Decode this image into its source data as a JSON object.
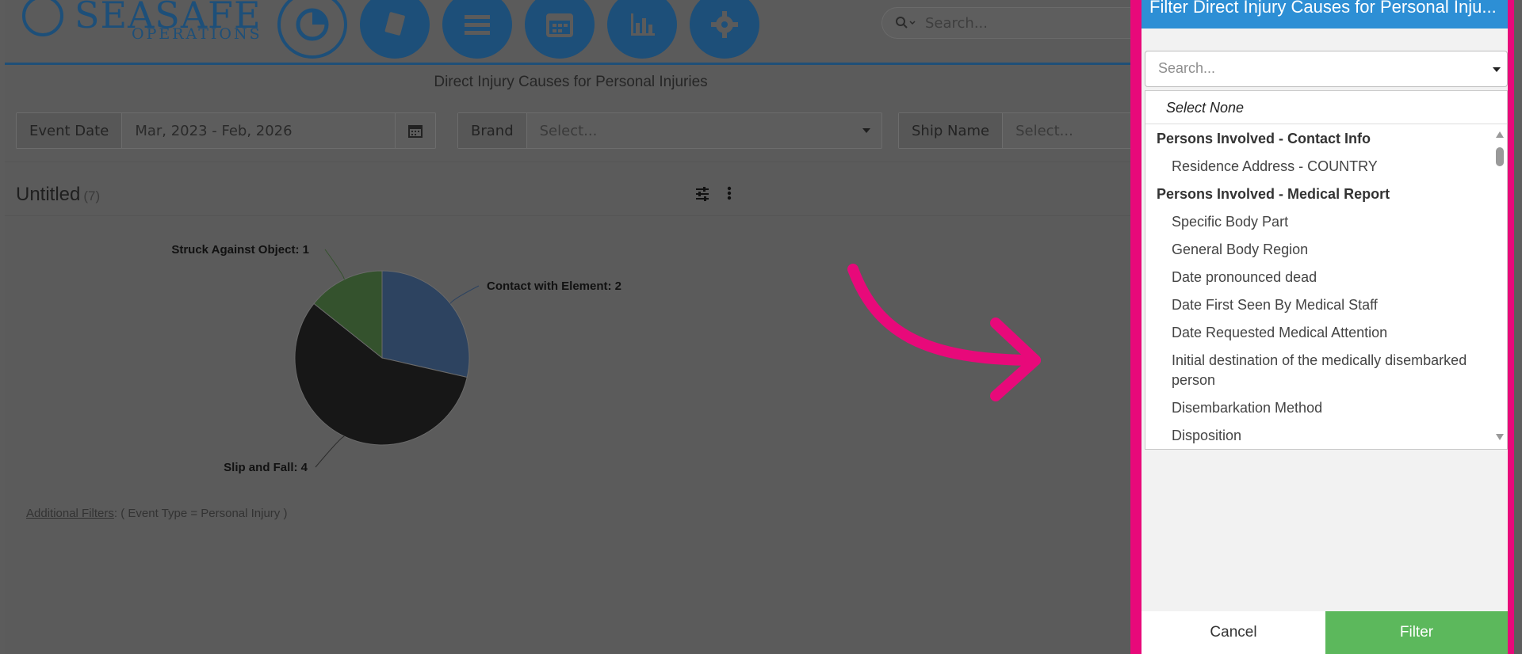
{
  "header": {
    "logo_main": "SEASAFE",
    "logo_sub": "OPERATIONS",
    "nav_icons": [
      "pie-chart-icon",
      "book-icon",
      "menu-icon",
      "calendar-icon",
      "bar-chart-icon",
      "gear-icon"
    ],
    "search_placeholder": "Search..."
  },
  "page_title": "Direct Injury Causes for Personal Injuries",
  "filters": {
    "event_date": {
      "label": "Event Date",
      "value": "Mar, 2023 - Feb, 2026"
    },
    "brand": {
      "label": "Brand",
      "placeholder": "Select..."
    },
    "ship_name": {
      "label": "Ship Name",
      "placeholder": "Select..."
    }
  },
  "widget": {
    "title": "Untitled",
    "count": "(7)",
    "additional_filters_label": "Additional Filters",
    "additional_filters_value": ": ( Event Type = Personal Injury )"
  },
  "chart_data": {
    "type": "pie",
    "slices": [
      {
        "label": "Contact with Element",
        "value": 2,
        "color": "#2d4360"
      },
      {
        "label": "Slip and Fall",
        "value": 4,
        "color": "#171717"
      },
      {
        "label": "Struck Against Object",
        "value": 1,
        "color": "#34522d"
      }
    ],
    "data_labels": [
      "Contact with Element: 2",
      "Slip and Fall: 4",
      "Struck Against Object: 1"
    ]
  },
  "panel": {
    "title": "Filter Direct Injury Causes for Personal Inju...",
    "search_placeholder": "Search...",
    "select_none": "Select None",
    "groups": [
      {
        "name": "Persons Involved - Contact Info",
        "options": [
          "Residence Address - COUNTRY"
        ]
      },
      {
        "name": "Persons Involved - Medical Report",
        "options": [
          "Specific Body Part",
          "General Body Region",
          "Date pronounced dead",
          "Date First Seen By Medical Staff",
          "Date Requested Medical Attention",
          "Initial destination of the medically disembarked person",
          "Disembarkation Method",
          "Disposition"
        ]
      }
    ],
    "cancel_label": "Cancel",
    "filter_label": "Filter"
  },
  "colors": {
    "accent_pink": "#e8097a",
    "header_blue": "#2d8fd5",
    "filter_green": "#5cb85c",
    "brand_navy": "#1d4f79"
  }
}
